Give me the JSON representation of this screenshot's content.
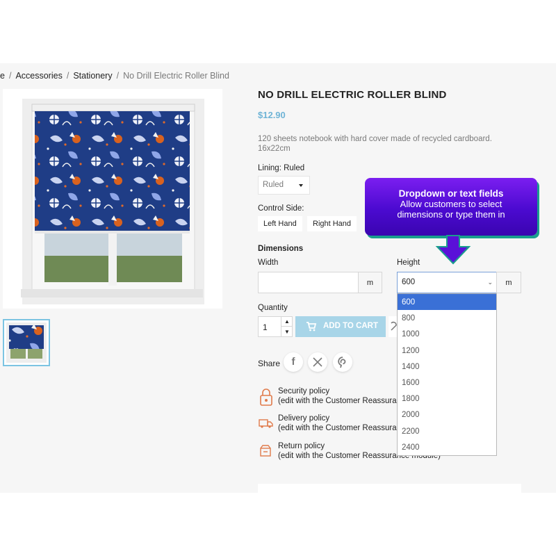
{
  "breadcrumb": {
    "home": "e",
    "accessories": "Accessories",
    "stationery": "Stationery",
    "current": "No Drill Electric Roller Blind"
  },
  "product": {
    "title": "NO DRILL ELECTRIC ROLLER BLIND",
    "price": "$12.90",
    "description": "120 sheets notebook with hard cover made of recycled cardboard. 16x22cm"
  },
  "lining": {
    "label": "Lining: Ruled",
    "selected": "Ruled"
  },
  "control_side": {
    "label": "Control Side:",
    "options": [
      "Left Hand",
      "Right Hand"
    ]
  },
  "dimensions": {
    "title": "Dimensions",
    "width_label": "Width",
    "height_label": "Height",
    "width_value": "",
    "width_unit": "m",
    "height_unit": "m",
    "height_selected": "600",
    "height_options": [
      "600",
      "800",
      "1000",
      "1200",
      "1400",
      "1600",
      "1800",
      "2000",
      "2200",
      "2400"
    ]
  },
  "quantity": {
    "label": "Quantity",
    "value": "1"
  },
  "add_to_cart": {
    "label": "ADD TO CART"
  },
  "share": {
    "label": "Share",
    "icons": [
      "facebook-icon",
      "x-icon",
      "pinterest-icon"
    ]
  },
  "reassurance": [
    {
      "title": "Security policy",
      "subtitle": "(edit with the Customer Reassurance module)"
    },
    {
      "title": "Delivery policy",
      "subtitle": "(edit with the Customer Reassurance module)"
    },
    {
      "title": "Return policy",
      "subtitle": "(edit with the Customer Reassurance module)"
    }
  ],
  "callout": {
    "title": "Dropdown or text fields",
    "line1": "Allow customers to select",
    "line2": "dimensions or type them in"
  },
  "colors": {
    "accent": "#6fb4d6",
    "button": "#a8d5e8",
    "callout": "#5a0fe0",
    "callout_shadow": "#1a9e8e",
    "selected_option": "#3a70d6"
  }
}
